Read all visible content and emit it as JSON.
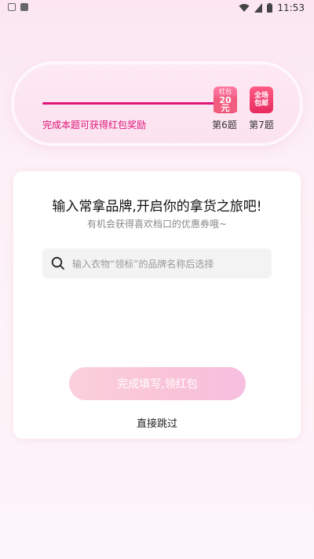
{
  "status_bar": {
    "time": "11:53"
  },
  "progress": {
    "reward_text": "完成本题可获得红包奖励",
    "milestones": [
      {
        "label": "第6题",
        "badge_top": "红包",
        "badge_amount": "20元"
      },
      {
        "label": "第7题",
        "badge_line1": "全场",
        "badge_line2": "包邮"
      }
    ]
  },
  "card": {
    "title": "输入常拿品牌,开启你的拿货之旅吧!",
    "subtitle": "有机会获得喜欢档口的优惠券哦~",
    "search_placeholder": "输入衣物“领标”的品牌名称后选择",
    "submit_label": "完成填写,领红包",
    "skip_label": "直接跳过"
  },
  "colors": {
    "accent": "#e0157a",
    "button": "#f9c3d7"
  }
}
